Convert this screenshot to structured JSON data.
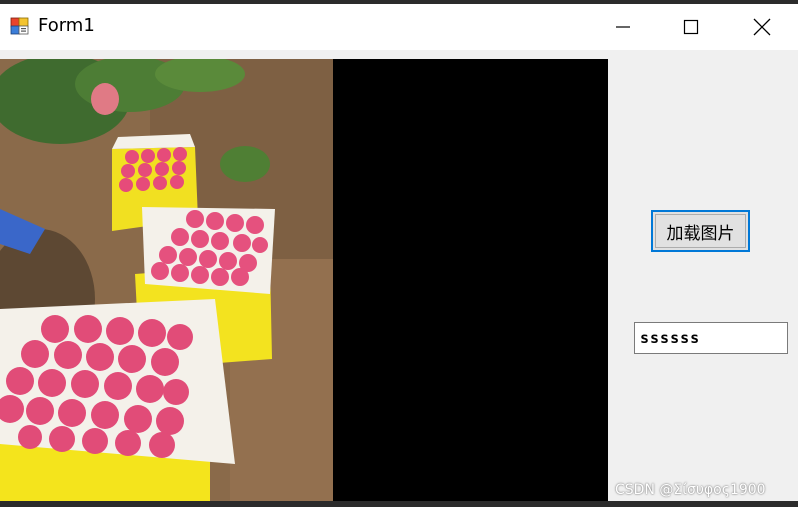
{
  "window": {
    "title": "Form1",
    "icon": "winforms-app-icon",
    "controls": {
      "minimize": "minimize-icon",
      "maximize": "maximize-icon",
      "close": "close-icon"
    }
  },
  "picturebox": {
    "image_description_icon": "photo-apple-crates",
    "background": "#000000"
  },
  "load_button": {
    "label": "加载图片",
    "focus_color": "#0078d7"
  },
  "textbox": {
    "value": "ssssss"
  },
  "watermark": {
    "text": "CSDN @Σίσυφος1900"
  }
}
